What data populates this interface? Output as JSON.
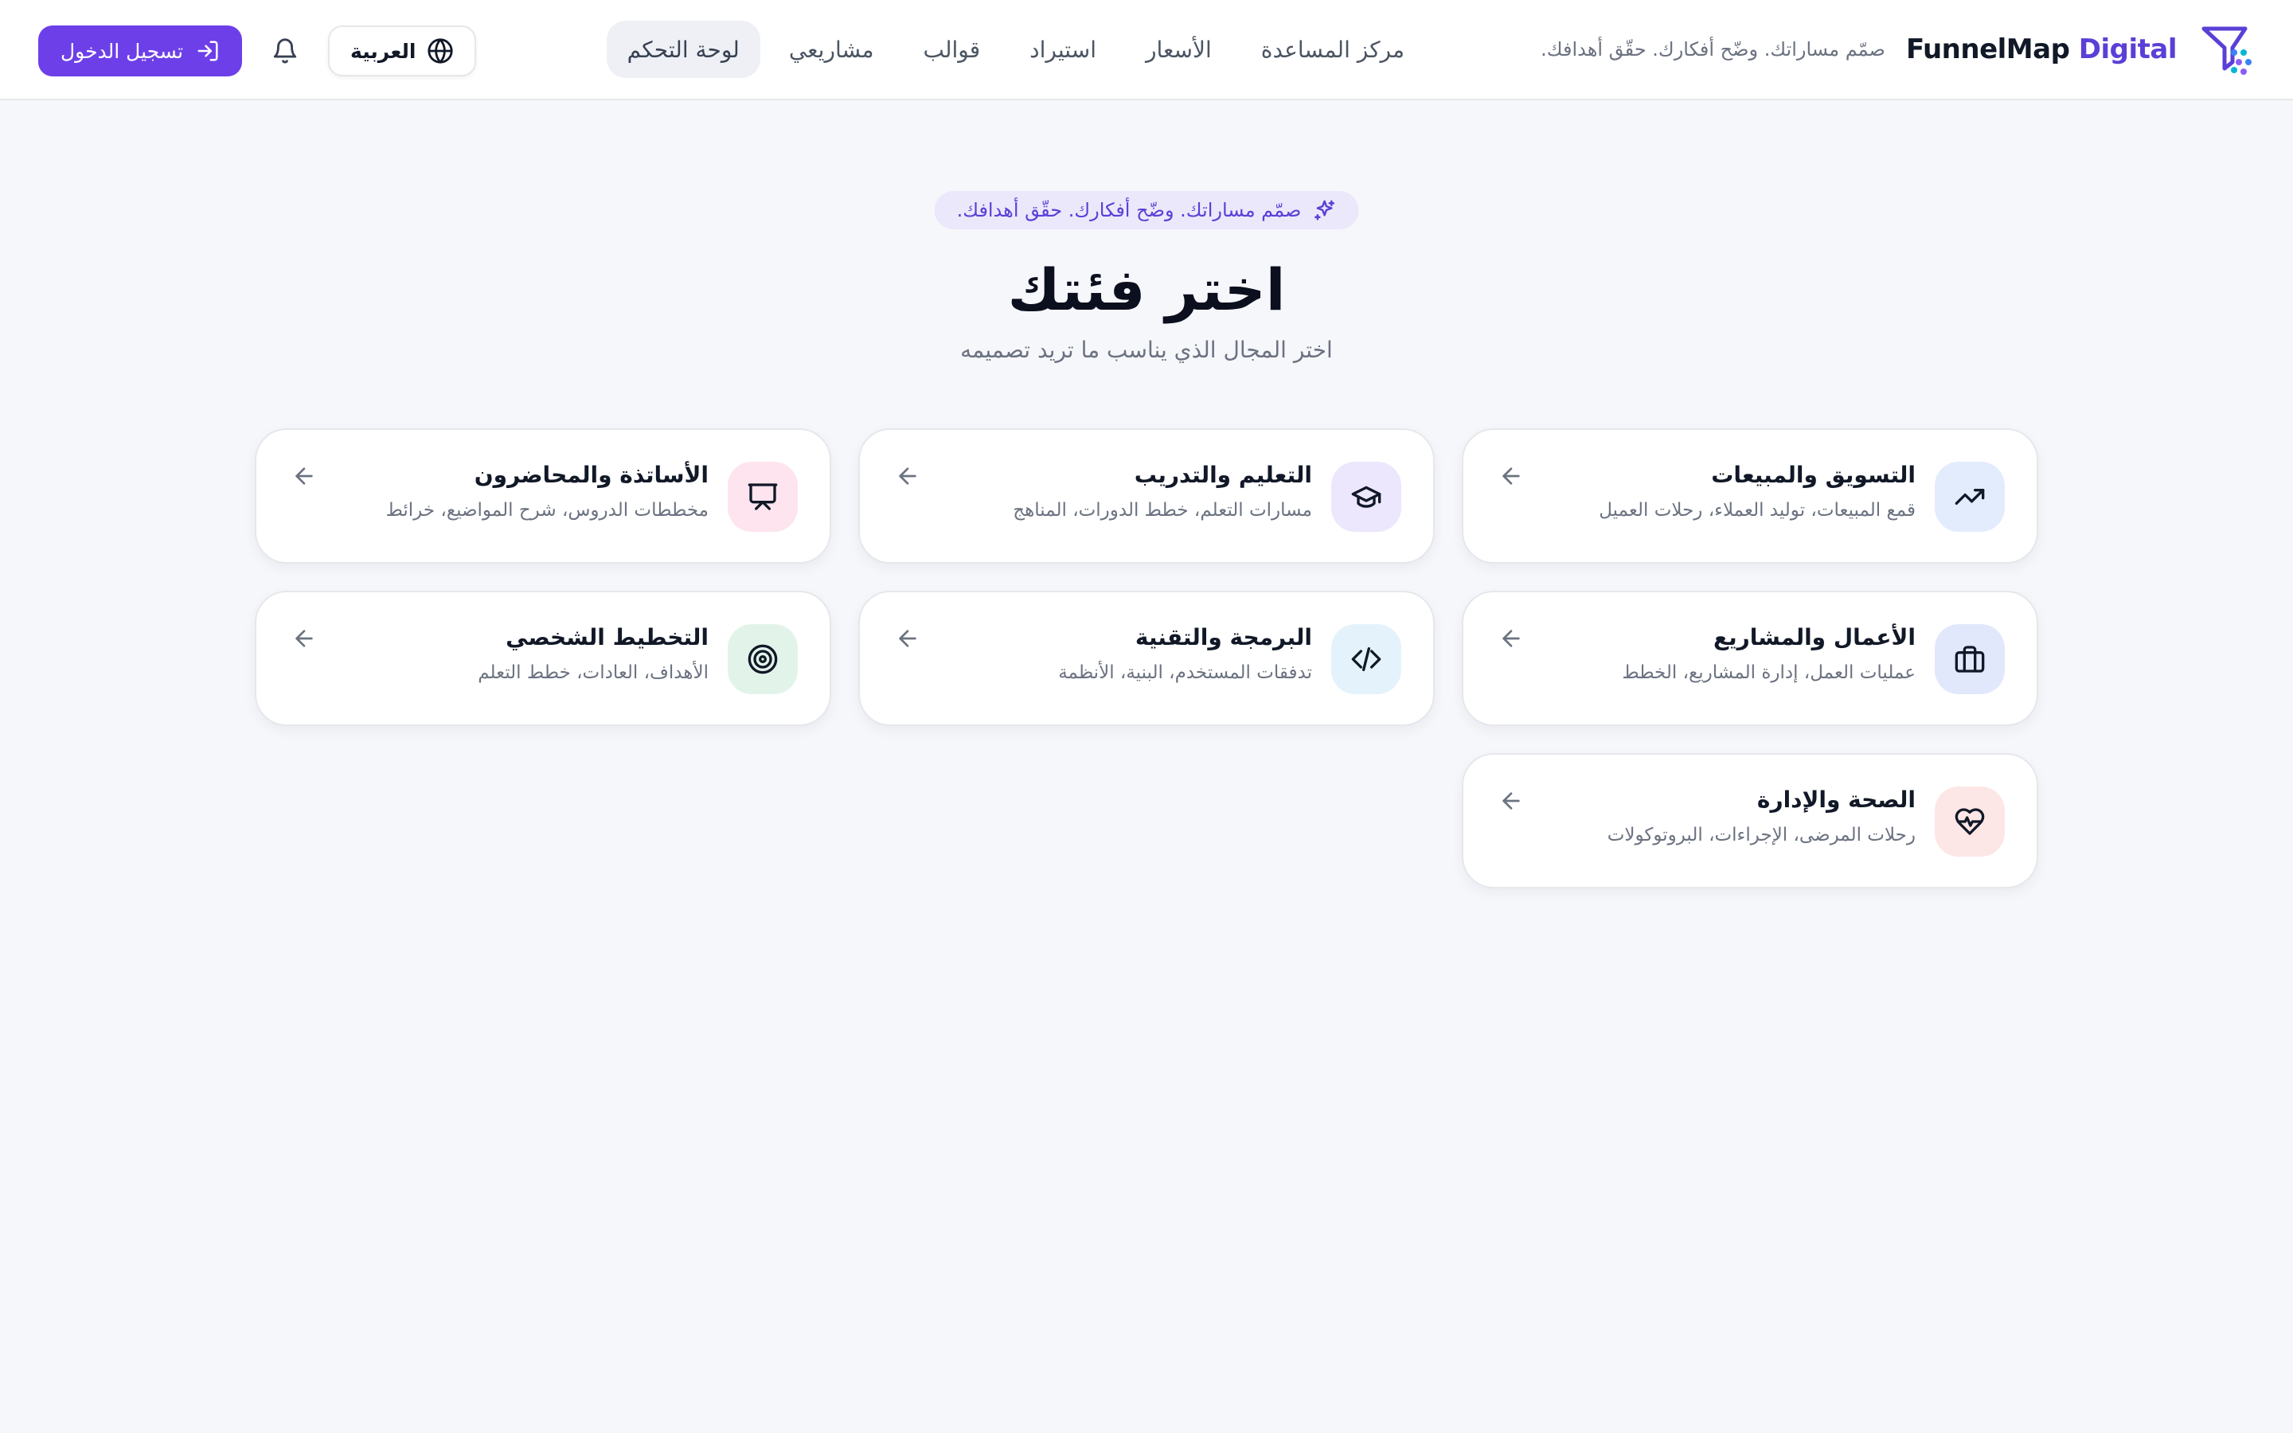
{
  "header": {
    "brand_prefix": "FunnelMap",
    "brand_accent": "Digital",
    "tagline": "صمّم مساراتك. وضّح أفكارك. حقّق أهدافك.",
    "nav": [
      {
        "label": "لوحة التحكم",
        "active": true
      },
      {
        "label": "مشاريعي",
        "active": false
      },
      {
        "label": "قوالب",
        "active": false
      },
      {
        "label": "استيراد",
        "active": false
      },
      {
        "label": "الأسعار",
        "active": false
      },
      {
        "label": "مركز المساعدة",
        "active": false
      }
    ],
    "language_label": "العربية",
    "login_label": "تسجيل الدخول"
  },
  "hero": {
    "pill": "صمّم مساراتك. وضّح أفكارك. حقّق أهدافك.",
    "title": "اختر فئتك",
    "subtitle": "اختر المجال الذي يناسب ما تريد تصميمه"
  },
  "categories": [
    {
      "title": "التسويق والمبيعات",
      "description": "قمع المبيعات، توليد العملاء، رحلات العميل",
      "icon": "trending-up-icon",
      "icon_bg": "#e3ecfd"
    },
    {
      "title": "التعليم والتدريب",
      "description": "مسارات التعلم، خطط الدورات، المناهج",
      "icon": "graduation-cap-icon",
      "icon_bg": "#ece7fd"
    },
    {
      "title": "الأساتذة والمحاضرون",
      "description": "مخططات الدروس، شرح المواضيع، خرائط",
      "icon": "presentation-icon",
      "icon_bg": "#fde4ee"
    },
    {
      "title": "الأعمال والمشاريع",
      "description": "عمليات العمل، إدارة المشاريع، الخطط",
      "icon": "briefcase-icon",
      "icon_bg": "#e2e8fb"
    },
    {
      "title": "البرمجة والتقنية",
      "description": "تدفقات المستخدم، البنية، الأنظمة",
      "icon": "code-icon",
      "icon_bg": "#e4f3fb"
    },
    {
      "title": "التخطيط الشخصي",
      "description": "الأهداف، العادات، خطط التعلم",
      "icon": "target-icon",
      "icon_bg": "#e2f4ea"
    },
    {
      "title": "الصحة والإدارة",
      "description": "رحلات المرضى، الإجراءات، البروتوكولات",
      "icon": "heart-pulse-icon",
      "icon_bg": "#fde6e6"
    }
  ],
  "colors": {
    "primary": "#6d3fe8",
    "accent_text": "#5b3fd6",
    "page_bg": "#f6f7fb"
  }
}
